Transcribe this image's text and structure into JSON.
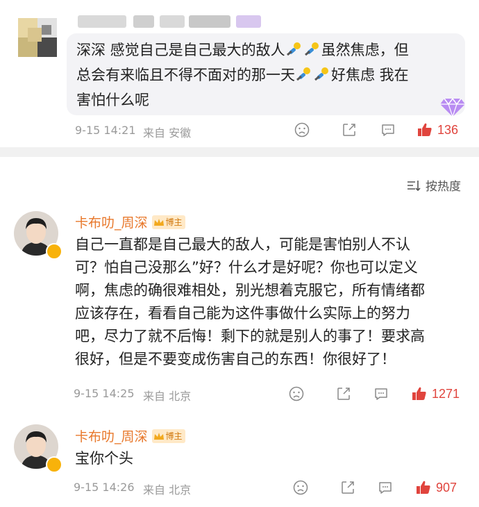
{
  "post": {
    "text_line1_a": "深深 感觉自己是自己最大的敌人",
    "text_line1_b": "虽然焦虑，但",
    "text_line2_a": "总会有来临且不得不面对的那一天",
    "text_line2_b": "好焦虑 我在",
    "text_line3": "害怕什么呢",
    "time": "9-15 14:21",
    "location": "来自 安徽",
    "likes": "136"
  },
  "sort": {
    "label": "按热度"
  },
  "comments": [
    {
      "username": "卡布叻_周深",
      "badge": "博主",
      "lines": [
        "自己一直都是自己最大的敌人，可能是害怕别人不认",
        "可？怕自己没那么”好？什么才是好呢？你也可以定义",
        "啊，焦虑的确很难相处，别光想着克服它，所有情绪都",
        "应该存在，看看自己能为这件事做什么实际上的努力",
        "吧，尽力了就不后悔！剩下的就是别人的事了！要求高",
        "很好，但是不要变成伤害自己的东西！你很好了！"
      ],
      "time": "9-15 14:25",
      "location": "来自 北京",
      "likes": "1271"
    },
    {
      "username": "卡布叻_周深",
      "badge": "博主",
      "lines": [
        "宝你个头"
      ],
      "time": "9-15 14:26",
      "location": "来自 北京",
      "likes": "907"
    }
  ],
  "colors": {
    "like": "#e0443d",
    "username": "#e8782b",
    "meta": "#9a9a9a"
  }
}
